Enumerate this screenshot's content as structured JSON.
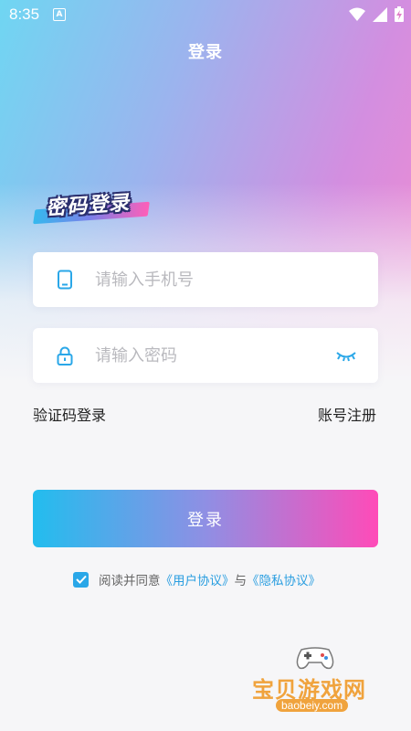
{
  "status_bar": {
    "time": "8:35",
    "notification_glyph": "A",
    "icons": [
      "wifi-icon",
      "signal-icon",
      "battery-charging-icon"
    ]
  },
  "header": {
    "title": "登录"
  },
  "logo": {
    "text": "密码登录"
  },
  "form": {
    "phone": {
      "placeholder": "请输入手机号",
      "icon": "phone-icon"
    },
    "password": {
      "placeholder": "请输入密码",
      "icon": "lock-icon",
      "toggle_icon": "eye-closed-icon"
    }
  },
  "links": {
    "sms_login": "验证码登录",
    "register": "账号注册"
  },
  "login_button": "登录",
  "agreement": {
    "checked": true,
    "prefix": "阅读并同意",
    "user_agreement": "《用户协议》",
    "conjunction": "与",
    "privacy_policy": "《隐私协议》"
  },
  "watermark": {
    "name": "宝贝游戏网",
    "url": "baobeiy.com"
  },
  "colors": {
    "accent_blue": "#2aa7e8",
    "gradient_start": "#22bdee",
    "gradient_end": "#ff4bb8",
    "watermark": "#f0a33d"
  }
}
